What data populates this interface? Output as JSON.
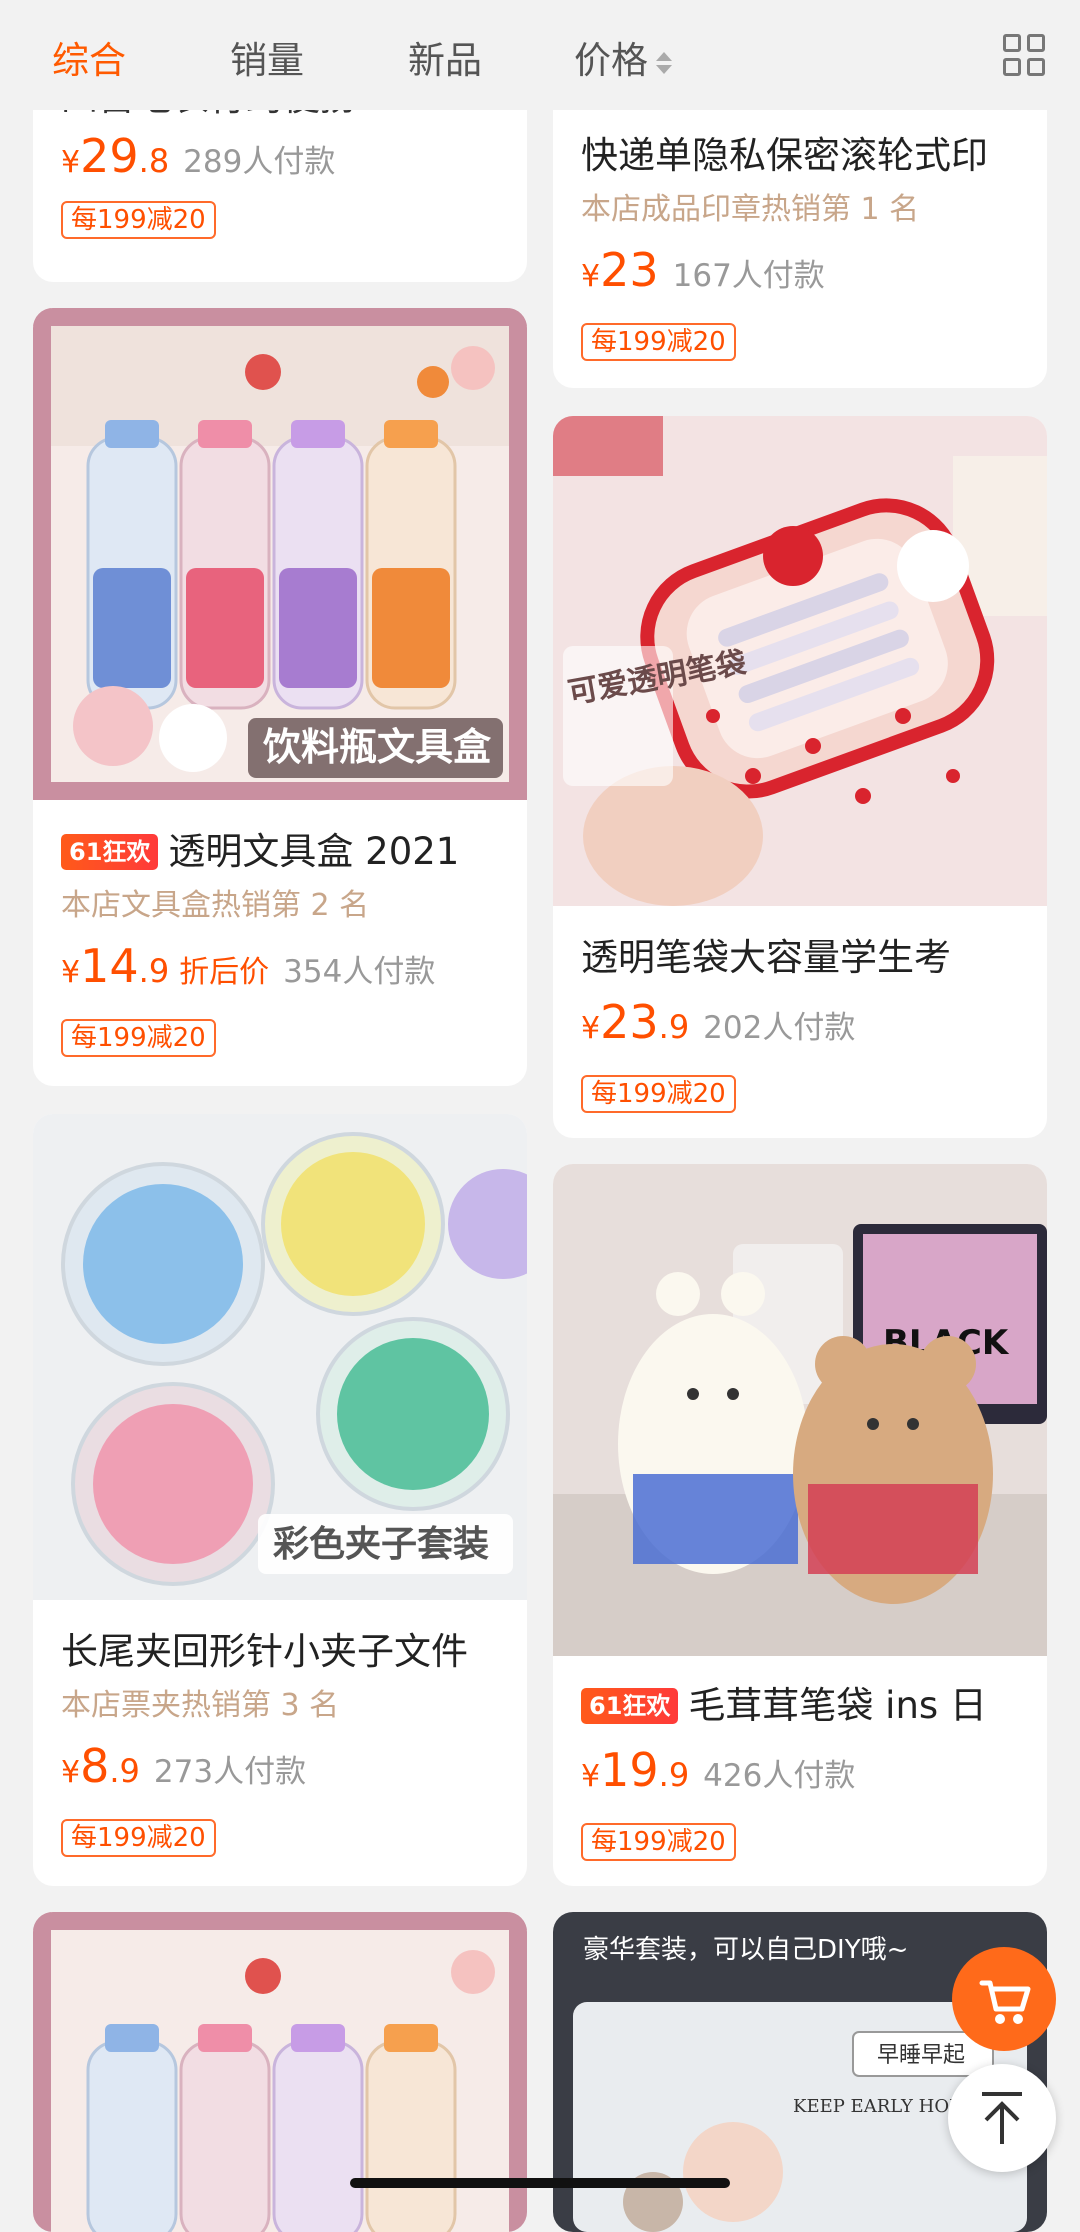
{
  "tabs": {
    "comprehensive": "综合",
    "sales": "销量",
    "new": "新品",
    "price": "价格"
  },
  "colors": {
    "accent": "#ff5a00",
    "price": "#ff4f00"
  },
  "products": {
    "p1": {
      "title": "四旨毛衣行约便捞",
      "price_int": "29",
      "price_dec": ".8",
      "sold": "289人付款",
      "coupon": "每199减20"
    },
    "p2": {
      "title": "快递单隐私保密滚轮式印",
      "rank": "本店成品印章热销第 1 名",
      "price_int": "23",
      "price_dec": "",
      "sold": "167人付款",
      "coupon": "每199减20"
    },
    "p3": {
      "badge": "61狂欢",
      "title": "透明文具盒 2021",
      "rank": "本店文具盒热销第 2 名",
      "price_int": "14",
      "price_dec": ".9",
      "price_tag": "折后价",
      "sold": "354人付款",
      "coupon": "每199减20",
      "image_caption": "饮料瓶文具盒"
    },
    "p4": {
      "title": "透明笔袋大容量学生考",
      "price_int": "23",
      "price_dec": ".9",
      "sold": "202人付款",
      "coupon": "每199减20",
      "image_caption": "可爱透明笔袋"
    },
    "p5": {
      "title": "长尾夹回形针小夹子文件",
      "rank": "本店票夹热销第 3 名",
      "price_int": "8",
      "price_dec": ".9",
      "sold": "273人付款",
      "coupon": "每199减20",
      "image_caption": "彩色夹子套装"
    },
    "p6": {
      "badge": "61狂欢",
      "title": "毛茸茸笔袋 ins 日",
      "price_int": "19",
      "price_dec": ".9",
      "sold": "426人付款",
      "coupon": "每199减20",
      "image_text": "BLACK"
    },
    "p8": {
      "image_caption": "豪华套装，可以自己DIY哦~",
      "image_sign": "早睡早起",
      "image_sign_en": "KEEP EARLY HOURS"
    }
  },
  "currency": "¥",
  "icons": {
    "grid": "grid-view-icon",
    "cart": "cart-icon",
    "top": "back-to-top-icon"
  }
}
